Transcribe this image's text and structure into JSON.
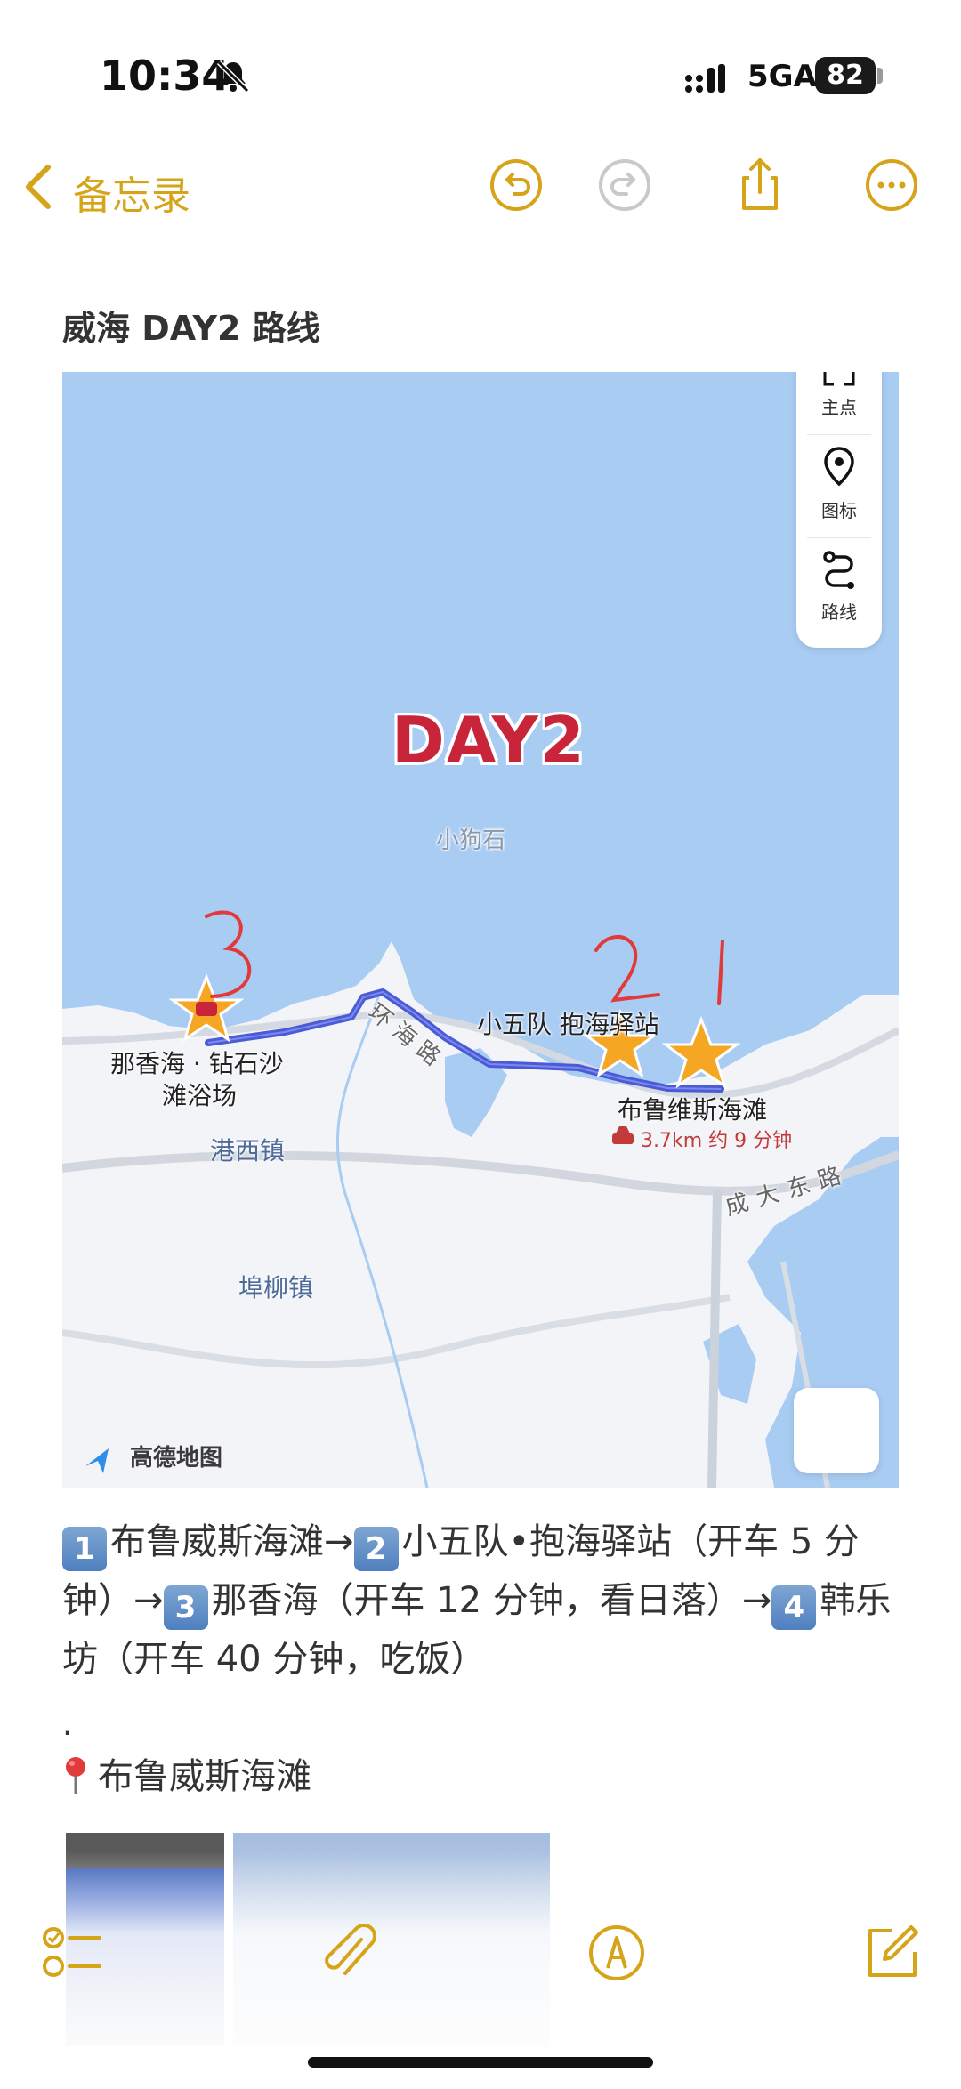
{
  "status": {
    "time": "10:34",
    "network": "5GA",
    "battery": "82",
    "icons": [
      "bell-slash-icon",
      "signal-icon",
      "battery-icon"
    ]
  },
  "nav": {
    "back_label": "备忘录",
    "icons": [
      "chevron-left-icon",
      "undo-icon",
      "redo-icon",
      "share-icon",
      "more-icon"
    ],
    "accent": "#d6a419"
  },
  "note": {
    "title": "威海 DAY2 路线"
  },
  "map": {
    "panel": [
      {
        "icon": "main-point-icon",
        "label": "主点"
      },
      {
        "icon": "pin-icon",
        "label": "图标"
      },
      {
        "icon": "route-icon",
        "label": "路线"
      }
    ],
    "day_label": "DAY2",
    "annotations": [
      "3",
      "2",
      "1"
    ],
    "labels": {
      "xiaogoushi": "小狗石",
      "huanhai_road": "环海路",
      "stop2": "小五队 抱海驿站",
      "stop3_line1": "那香海 · 钻石沙",
      "stop3_line2": "滩浴场",
      "stop1": "布鲁维斯海滩",
      "route_info": "3.7km 约 9 分钟",
      "gangxi": "港西镇",
      "chengda_road": "成大东路",
      "fuliu": "埠柳镇",
      "provider": "高德地图"
    },
    "colors": {
      "sea": "#a9ccf3",
      "land": "#f2f4f8",
      "route": "#4b5bd6",
      "star": "#f5a623",
      "handwriting": "#e23a3a"
    }
  },
  "body": {
    "route_text": {
      "n1": "1",
      "s1": "布鲁威斯海滩→",
      "n2": "2",
      "s2": "小五队•抱海驿站（开车 5 分钟）→",
      "n3": "3",
      "s3": "那香海（开车 12 分钟，看日落）→",
      "n4": "4",
      "s4": "韩乐坊（开车 40 分钟，吃饭）"
    },
    "dot": ".",
    "pin_line": "布鲁威斯海滩"
  },
  "toolbar": {
    "icons": [
      "checklist-icon",
      "paperclip-icon",
      "markup-pen-icon",
      "compose-icon"
    ]
  }
}
